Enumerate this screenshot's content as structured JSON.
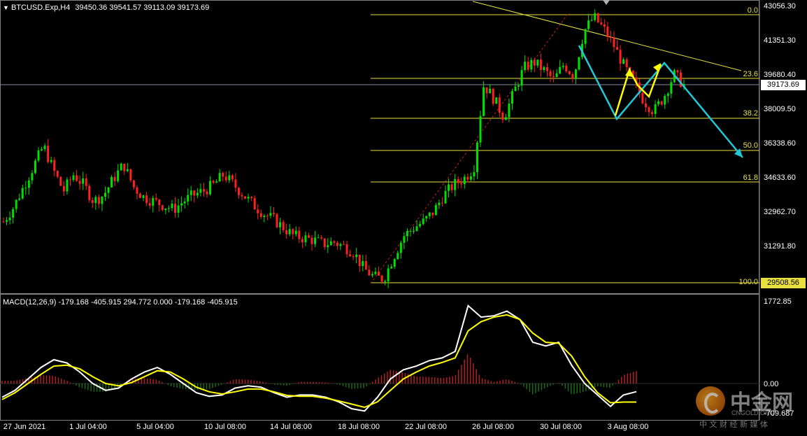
{
  "header": {
    "arrow": "▼",
    "symbol": "BTCUSD.Exp,H4",
    "ohlc": "39450.36 39541.57 39113.09 39173.69"
  },
  "macd_header": {
    "label": "MACD(12,26,9) -179.168 -405.915 294.772 0.000 -179.168 -405.915"
  },
  "price_axis": {
    "labels": [
      "43056.30",
      "41351.30",
      "39680.40",
      "38009.50",
      "36338.60",
      "34633.60",
      "32962.70",
      "31291.80"
    ],
    "current_price": "39173.69",
    "low_price": "29508.56"
  },
  "macd_axis": {
    "top": "1772.85",
    "zero": "0.00",
    "bottom": "-709.687"
  },
  "fibonacci": {
    "levels": [
      "0.0",
      "23.6",
      "38.2",
      "50.0",
      "61.8",
      "100.0"
    ]
  },
  "time_axis": {
    "labels": [
      "27 Jun 2021",
      "1 Jul 04:00",
      "5 Jul 04:00",
      "10 Jul 08:00",
      "14 Jul 08:00",
      "18 Jul 08:00",
      "22 Jul 08:00",
      "26 Jul 08:00",
      "30 Jul 08:00",
      "3 Aug 08:00"
    ]
  },
  "watermark": {
    "brand": "中金网",
    "domain": "CNGOLD.ORG",
    "slogan": "中 文 财 经 新 媒 体"
  },
  "colors": {
    "bull": "#00e000",
    "bear": "#ff2020",
    "fib": "#e8e040",
    "macd_line": "#ffffff",
    "signal_line": "#ffff00",
    "hist_pos": "#b02020",
    "hist_neg": "#1a6a1a",
    "arrow_blue": "#20c8d8",
    "arrow_yellow": "#ffff00",
    "axis_tag_bg": "#ffffff"
  },
  "chart_data": {
    "type": "candlestick",
    "close_path": [
      32500,
      33200,
      34200,
      35200,
      36200,
      35000,
      34000,
      34800,
      34300,
      33500,
      33800,
      34600,
      35300,
      34200,
      33700,
      33500,
      33300,
      33100,
      33500,
      33800,
      34000,
      34300,
      34800,
      34300,
      33800,
      33300,
      32900,
      32600,
      32200,
      31800,
      31700,
      31600,
      31400,
      31500,
      31300,
      31000,
      30200,
      29800,
      29700,
      30800,
      31800,
      32200,
      32500,
      33000,
      33800,
      34300,
      34600,
      35100,
      39200,
      38500,
      37600,
      38800,
      40000,
      40300,
      39900,
      39400,
      40200,
      39600,
      41800,
      42500,
      41900,
      41100,
      40100,
      39300,
      38400,
      37900,
      38600,
      39700,
      39173
    ],
    "macd_path": [
      -300,
      -150,
      100,
      350,
      520,
      450,
      250,
      0,
      -150,
      -100,
      100,
      250,
      350,
      200,
      0,
      -200,
      -280,
      -250,
      -100,
      -50,
      -80,
      -200,
      -300,
      -250,
      -250,
      -300,
      -400,
      -550,
      -600,
      -300,
      100,
      300,
      380,
      500,
      560,
      700,
      1700,
      1450,
      1480,
      1580,
      1400,
      900,
      820,
      900,
      400,
      0,
      -250,
      -500,
      -250,
      -179
    ],
    "signal_path": [
      -350,
      -200,
      0,
      200,
      380,
      400,
      320,
      150,
      0,
      -50,
      20,
      150,
      280,
      250,
      100,
      -80,
      -180,
      -230,
      -180,
      -120,
      -120,
      -180,
      -260,
      -280,
      -280,
      -320,
      -380,
      -450,
      -520,
      -400,
      -150,
      100,
      250,
      380,
      460,
      560,
      1150,
      1350,
      1450,
      1500,
      1400,
      1100,
      900,
      880,
      600,
      150,
      -200,
      -420,
      -405,
      -405
    ],
    "annotations": [
      "Fibonacci retracement 0.0-100.0",
      "projected zigzag path",
      "descending trendline"
    ]
  }
}
